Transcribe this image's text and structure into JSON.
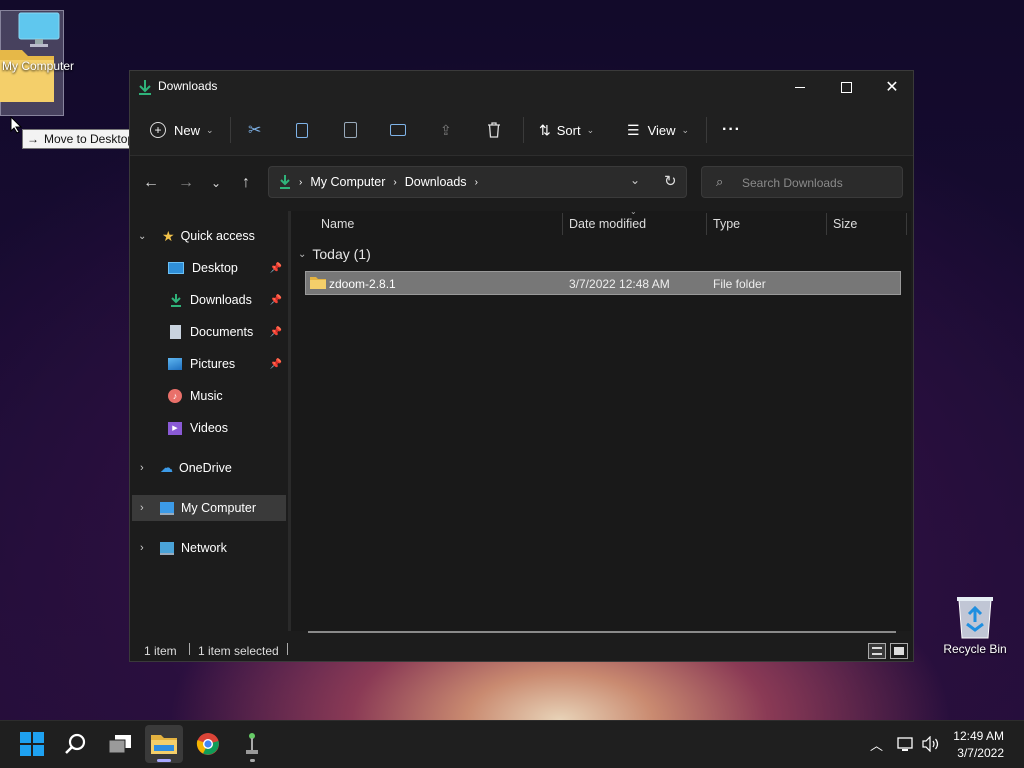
{
  "desktop": {
    "drag_icon_label": "My Computer",
    "tooltip": "Move to Desktop",
    "recycle_bin_label": "Recycle Bin"
  },
  "window": {
    "title": "Downloads"
  },
  "toolbar": {
    "new_label": "New",
    "sort_label": "Sort",
    "view_label": "View",
    "more_label": "···"
  },
  "address": {
    "crumbs": [
      "My Computer",
      "Downloads"
    ]
  },
  "search": {
    "placeholder": "Search Downloads"
  },
  "nav": {
    "quick_access": "Quick access",
    "items": [
      {
        "label": "Desktop",
        "pinned": true
      },
      {
        "label": "Downloads",
        "pinned": true
      },
      {
        "label": "Documents",
        "pinned": true
      },
      {
        "label": "Pictures",
        "pinned": true
      },
      {
        "label": "Music",
        "pinned": false
      },
      {
        "label": "Videos",
        "pinned": false
      }
    ],
    "onedrive": "OneDrive",
    "my_computer": "My Computer",
    "network": "Network"
  },
  "columns": {
    "name": "Name",
    "date_modified": "Date modified",
    "type": "Type",
    "size": "Size"
  },
  "group": {
    "label": "Today (1)"
  },
  "files": [
    {
      "name": "zdoom-2.8.1",
      "date": "3/7/2022 12:48 AM",
      "type": "File folder",
      "size": ""
    }
  ],
  "status": {
    "count": "1 item",
    "selected": "1 item selected"
  },
  "tray": {
    "time": "12:49 AM",
    "date": "3/7/2022"
  },
  "colors": {
    "accent_download": "#2fb37a",
    "folder_yellow": "#f2c24a",
    "taskbar_indicator": "#a7a7ff"
  }
}
